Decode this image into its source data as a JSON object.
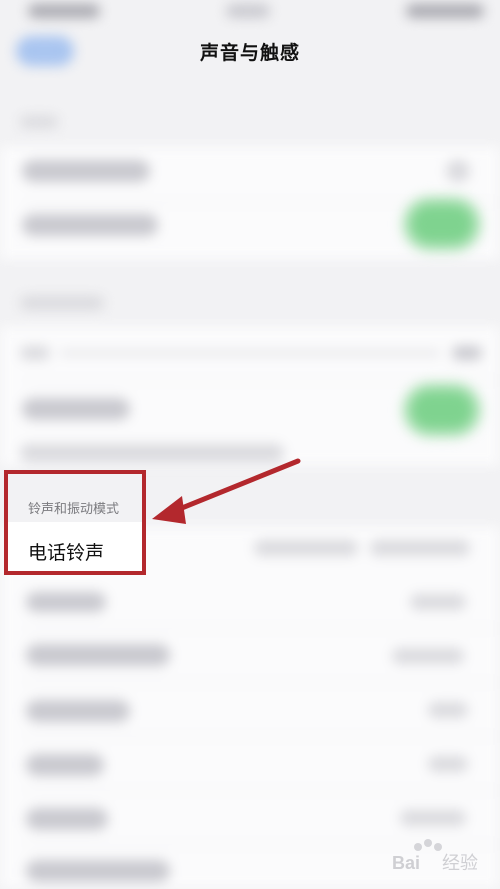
{
  "nav": {
    "title": "声音与触感"
  },
  "highlight": {
    "section_header": "铃声和振动模式",
    "item_label": "电话铃声"
  },
  "colors": {
    "annotation": "#b3282d",
    "toggle_on": "#7fd38f",
    "background": "#f2f2f4"
  },
  "watermark": {
    "text": "Bai 经验"
  }
}
